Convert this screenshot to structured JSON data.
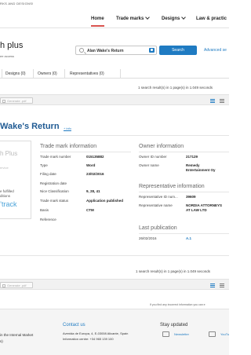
{
  "header": {
    "tagline": "rks and designs!",
    "nav": [
      {
        "label": "Home",
        "active": true
      },
      {
        "label": "Trade marks",
        "has_menu": true
      },
      {
        "label": "Designs",
        "has_menu": true
      },
      {
        "label": "Law & practic"
      }
    ]
  },
  "brand": {
    "title": "h plus",
    "subtitle": "ee access"
  },
  "search": {
    "value": "Alan Wake's Return",
    "button_label": "Search",
    "advanced_label": "Advanced se"
  },
  "tabs": [
    {
      "label": "Designs (0)"
    },
    {
      "label": "Owners (0)"
    },
    {
      "label": "Representatives (0)"
    }
  ],
  "results": {
    "summary": "1 search result(s) in 1 page(s) in 1.049 seconds",
    "generate_label": "Generate .pdf",
    "bottom_hint": "If you find any incorrect information you can e"
  },
  "trademark": {
    "title": "Wake's Return",
    "detail_link": "+ info",
    "image": {
      "line1": "h Plus",
      "line2": "ervice",
      "line3": "e fulfilled\nditions",
      "line4": "’track"
    },
    "info": {
      "heading": "Trade mark information",
      "rows": [
        {
          "label": "Trade mark number",
          "value": "015135882"
        },
        {
          "label": "Type",
          "value": "Word"
        },
        {
          "label": "Filing date",
          "value": "23/02/2016"
        },
        {
          "label": "Registration date",
          "value": ""
        },
        {
          "label": "Nice Classification",
          "value": "9, 28, 41"
        },
        {
          "label": "Trade mark status",
          "value": "Application published"
        },
        {
          "label": "Basis",
          "value": "CTM"
        },
        {
          "label": "Reference",
          "value": ""
        }
      ]
    },
    "owner": {
      "heading": "Owner information",
      "id_label": "Owner ID number",
      "id_value": "217129",
      "name_label": "Owner name",
      "name_value": "Remedy\nEntertainment Oy"
    },
    "representative": {
      "heading": "Representative information",
      "id_label": "Representative ID num...",
      "id_value": "39609",
      "name_label": "Representative name",
      "name_value": "NORDIA ATTORNEYS\nAT LAW LTD"
    },
    "publication": {
      "heading": "Last publication",
      "date": "26/02/2016",
      "section": "A.1"
    }
  },
  "footer": {
    "col1": [
      "in the Internal Market",
      "s)"
    ],
    "contact_heading": "Contact us",
    "contact_lines": [
      "Avenida de Europa, 4, E-03008 Alicante, Spain",
      "Information centre: +34 965 139 100"
    ],
    "stay_heading": "Stay updated",
    "newsletter_label": "Newsletter",
    "youtube_label": "YouTu"
  }
}
